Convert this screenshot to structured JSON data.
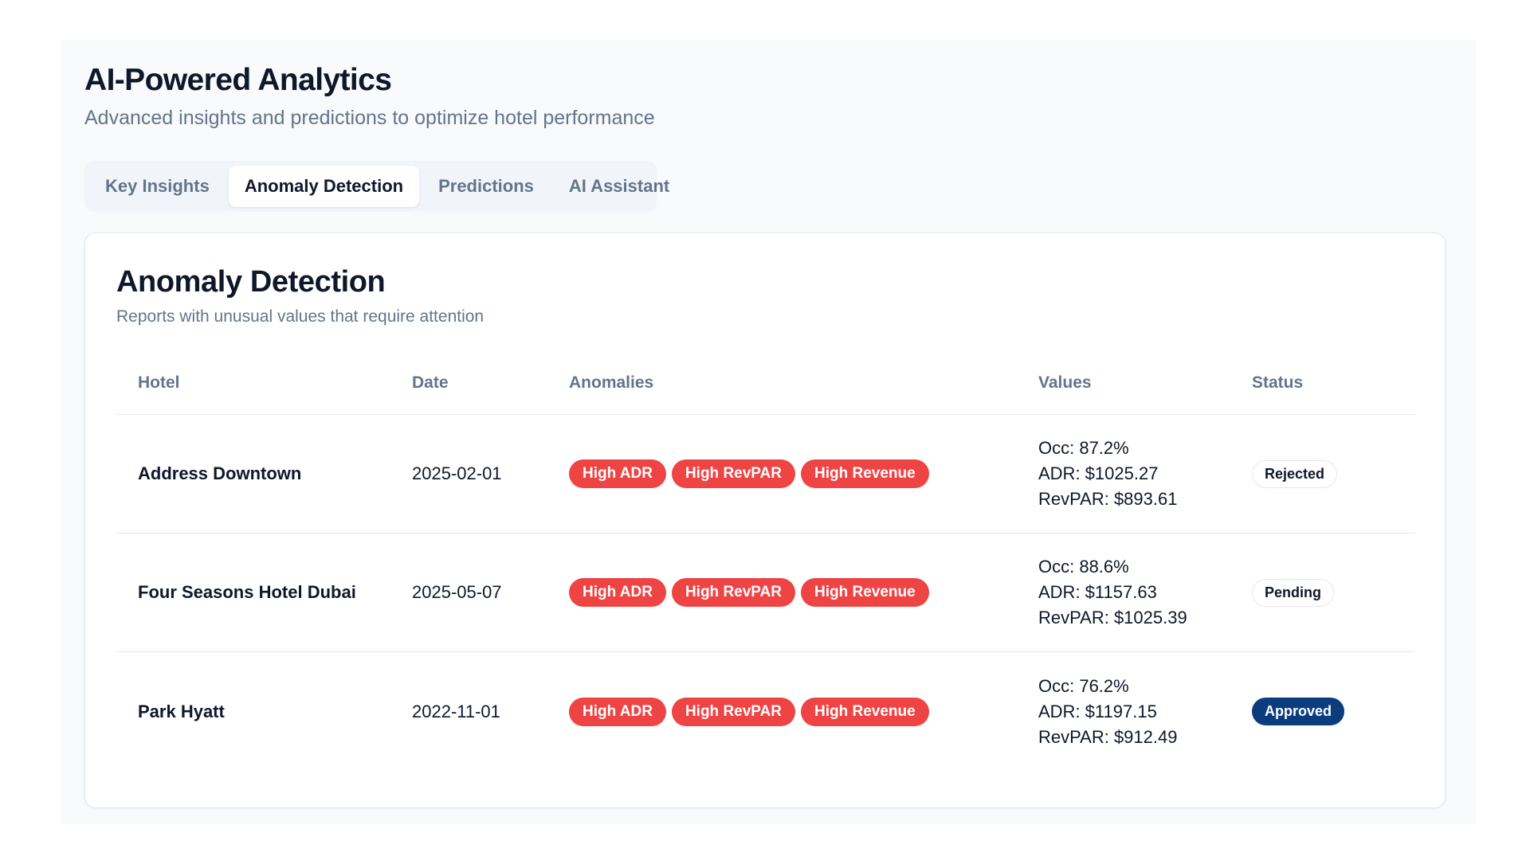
{
  "header": {
    "title": "AI-Powered Analytics",
    "subtitle": "Advanced insights and predictions to optimize hotel performance"
  },
  "tabs": [
    {
      "label": "Key Insights",
      "active": false
    },
    {
      "label": "Anomaly Detection",
      "active": true
    },
    {
      "label": "Predictions",
      "active": false
    },
    {
      "label": "AI Assistant",
      "active": false
    }
  ],
  "card": {
    "title": "Anomaly Detection",
    "subtitle": "Reports with unusual values that require attention"
  },
  "table": {
    "columns": [
      "Hotel",
      "Date",
      "Anomalies",
      "Values",
      "Status"
    ],
    "rows": [
      {
        "hotel": "Address Downtown",
        "date": "2025-02-01",
        "anomalies": [
          "High ADR",
          "High RevPAR",
          "High Revenue"
        ],
        "occ": "Occ: 87.2%",
        "adr": "ADR: $1025.27",
        "revpar": "RevPAR: $893.61",
        "status": "Rejected",
        "status_style": "outline"
      },
      {
        "hotel": "Four Seasons Hotel Dubai",
        "date": "2025-05-07",
        "anomalies": [
          "High ADR",
          "High RevPAR",
          "High Revenue"
        ],
        "occ": "Occ: 88.6%",
        "adr": "ADR: $1157.63",
        "revpar": "RevPAR: $1025.39",
        "status": "Pending",
        "status_style": "outline"
      },
      {
        "hotel": "Park Hyatt",
        "date": "2022-11-01",
        "anomalies": [
          "High ADR",
          "High RevPAR",
          "High Revenue"
        ],
        "occ": "Occ: 76.2%",
        "adr": "ADR: $1197.15",
        "revpar": "RevPAR: $912.49",
        "status": "Approved",
        "status_style": "filled"
      }
    ]
  },
  "colors": {
    "anomaly_badge": "#ef4444",
    "approved_badge": "#0b3d7e",
    "muted_text": "#64748b",
    "border": "#e2e8f0"
  }
}
